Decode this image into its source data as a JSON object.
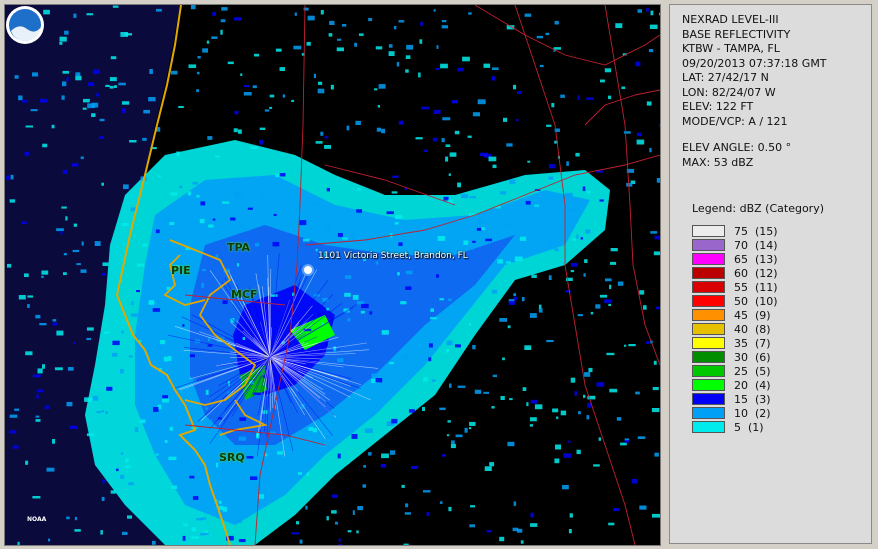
{
  "info": {
    "product": "NEXRAD LEVEL-III",
    "type": "BASE REFLECTIVITY",
    "station": "KTBW - TAMPA, FL",
    "datetime": "09/20/2013 07:37:18 GMT",
    "lat": "LAT: 27/42/17 N",
    "lon": "LON: 82/24/07 W",
    "elev": "ELEV: 122 FT",
    "mode": "MODE/VCP: A / 121",
    "elev_angle": "ELEV ANGLE: 0.50 °",
    "max": "MAX: 53 dBZ"
  },
  "legend": {
    "title": "Legend: dBZ (Category)",
    "entries": [
      {
        "label": "75  (15)",
        "color": "#ececec"
      },
      {
        "label": "70  (14)",
        "color": "#9966cc"
      },
      {
        "label": "65  (13)",
        "color": "#ff00ff"
      },
      {
        "label": "60  (12)",
        "color": "#bb0000"
      },
      {
        "label": "55  (11)",
        "color": "#d80000"
      },
      {
        "label": "50  (10)",
        "color": "#ff0000"
      },
      {
        "label": "45  (9)",
        "color": "#ff9100"
      },
      {
        "label": "40  (8)",
        "color": "#e7c000"
      },
      {
        "label": "35  (7)",
        "color": "#ffff00"
      },
      {
        "label": "30  (6)",
        "color": "#008e00"
      },
      {
        "label": "25  (5)",
        "color": "#01c701"
      },
      {
        "label": "20  (4)",
        "color": "#00ff00"
      },
      {
        "label": "15  (3)",
        "color": "#0000f6"
      },
      {
        "label": "10  (2)",
        "color": "#01a0f6"
      },
      {
        "label": "5  (1)",
        "color": "#00ecec"
      }
    ]
  },
  "map": {
    "places": [
      "TPA",
      "PIE",
      "MCF",
      "SRQ"
    ],
    "location_label": "1101 Victoria Street, Brandon, FL",
    "logo_text": "NOAA",
    "colors": {
      "water": "#0a0a3c",
      "coast": "#e0a800",
      "roads": "#c02030"
    }
  }
}
